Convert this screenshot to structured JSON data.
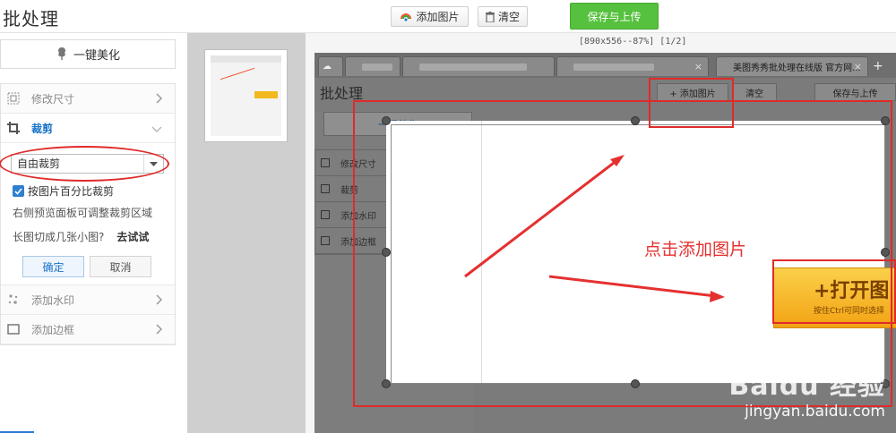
{
  "app": {
    "title": "批处理"
  },
  "toolbar": {
    "add_label": "添加图片",
    "clear_label": "清空",
    "save_label": "保存与上传"
  },
  "left_panel": {
    "one_click_label": "一键美化",
    "items": [
      {
        "label": "修改尺寸",
        "icon": "resize-icon"
      },
      {
        "label": "裁剪",
        "icon": "crop-icon",
        "active": true
      },
      {
        "label": "添加水印",
        "icon": "watermark-icon"
      },
      {
        "label": "添加边框",
        "icon": "border-icon"
      }
    ],
    "crop": {
      "mode_value": "自由裁剪",
      "checkbox_label": "按图片百分比裁剪",
      "checked": true,
      "hint": "右侧预览面板可调整裁剪区域",
      "cut_question": "长图切成几张小图?",
      "try_label": "去试试",
      "ok_label": "确定",
      "cancel_label": "取消"
    }
  },
  "preview": {
    "info": "[890x556--87%]  [1/2]",
    "inner": {
      "active_tab": "美图秀秀批处理在线版 官方网...",
      "title": "批处理",
      "add_label": "+ 添加图片",
      "clear_label": "清空",
      "save_label": "保存与上传",
      "one_click_label": "一键美化",
      "items": [
        "修改尺寸",
        "裁剪",
        "添加水印",
        "添加边框"
      ],
      "open_big": "+打开图",
      "open_small": "按住Ctrl可同时选择",
      "annotation": "点击添加图片"
    }
  },
  "watermark": {
    "line1": "Baidu 经验",
    "line2": "jingyan.baidu.com"
  },
  "colors": {
    "accent": "#1a73c7",
    "save_green": "#56c13e",
    "annotation_red": "#e02a2a"
  }
}
